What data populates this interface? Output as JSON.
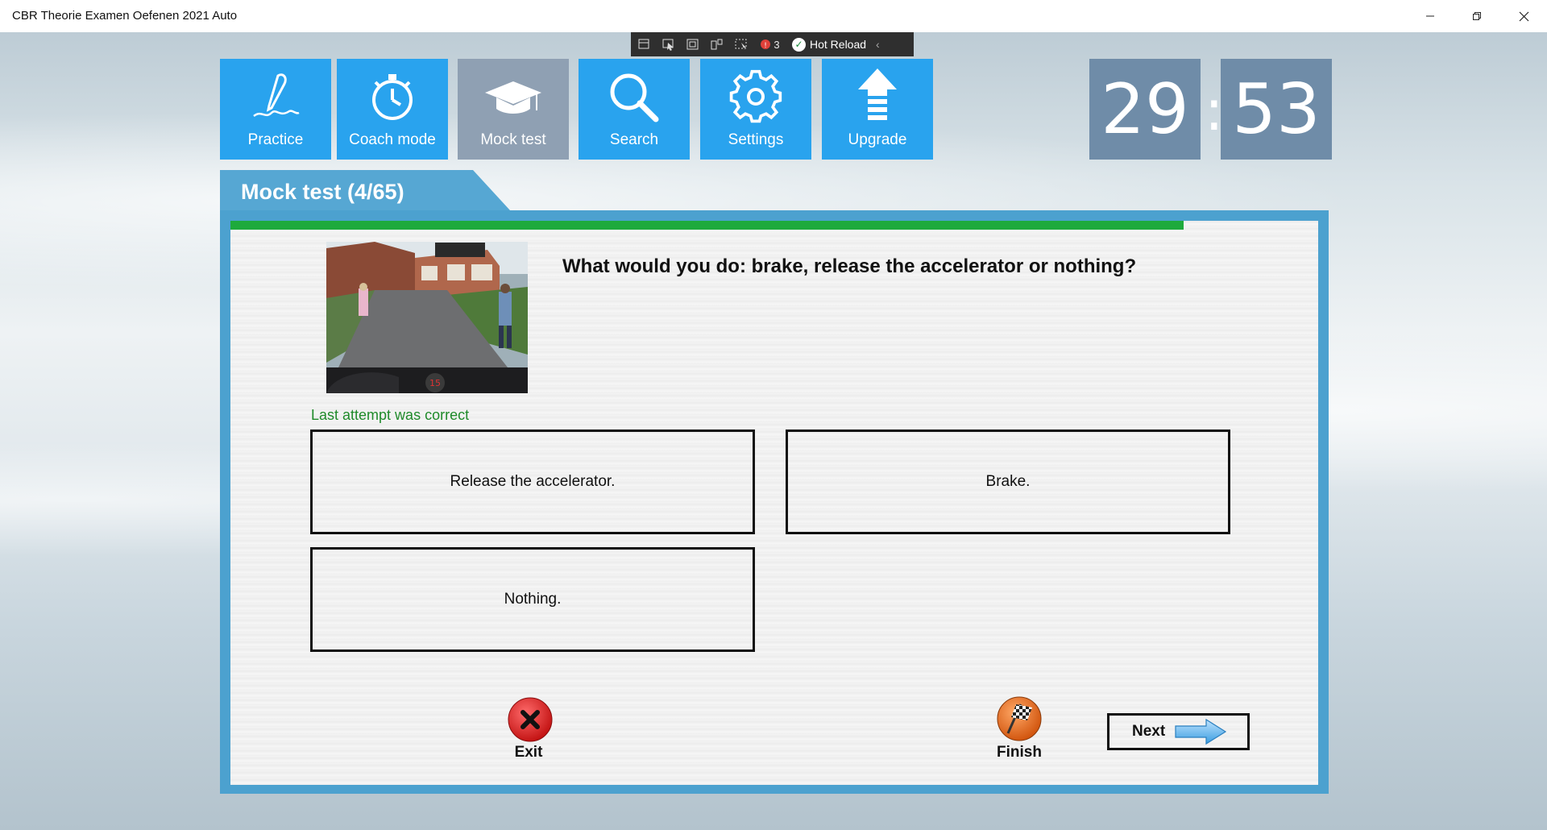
{
  "window": {
    "title": "CBR Theorie Examen Oefenen 2021 Auto",
    "controls": {
      "minimize": "—",
      "maximize": "❐",
      "close": "✕"
    }
  },
  "devbar": {
    "badge_count": "3",
    "hot_reload_label": "Hot Reload"
  },
  "nav": {
    "tiles": [
      {
        "label": "Practice",
        "icon": "pen-signature-icon"
      },
      {
        "label": "Coach mode",
        "icon": "stopwatch-icon"
      },
      {
        "label": "Mock test",
        "icon": "graduation-cap-icon"
      },
      {
        "label": "Search",
        "icon": "magnifier-icon"
      },
      {
        "label": "Settings",
        "icon": "gear-icon"
      },
      {
        "label": "Upgrade",
        "icon": "upload-arrow-icon"
      }
    ],
    "active": "Mock test"
  },
  "timer": {
    "minutes": "29",
    "seconds": "53",
    "separator": ":"
  },
  "panel": {
    "title": "Mock test (4/65)",
    "progress_fraction": 0.876
  },
  "question": {
    "text": "What would you do: brake, release the accelerator or nothing?",
    "speedometer_value": "15",
    "feedback": "Last attempt was correct"
  },
  "answers": [
    "Release the accelerator.",
    "Brake.",
    "Nothing."
  ],
  "actions": {
    "exit": "Exit",
    "finish": "Finish",
    "next": "Next"
  },
  "colors": {
    "tile_blue": "#29a3ee",
    "tile_active": "#8fa0b3",
    "timer_bg": "#6f8ca8",
    "panel_frame": "#4ca1cf",
    "progress_green": "#1eaa3c",
    "feedback_green": "#1f8a2a"
  }
}
